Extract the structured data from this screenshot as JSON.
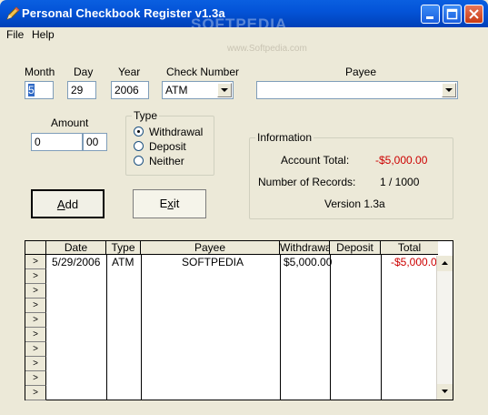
{
  "window": {
    "title": "Personal Checkbook Register v1.3a",
    "watermark": "SOFTPEDIA",
    "watermark_url": "www.Softpedia.com"
  },
  "menu": {
    "file": "File",
    "help": "Help"
  },
  "form": {
    "month_label": "Month",
    "month_value": "5",
    "day_label": "Day",
    "day_value": "29",
    "year_label": "Year",
    "year_value": "2006",
    "check_number_label": "Check Number",
    "check_number_value": "ATM",
    "payee_label": "Payee",
    "payee_value": "",
    "amount_label": "Amount",
    "amount_dollars": "0",
    "amount_cents": "00"
  },
  "type_group": {
    "title": "Type",
    "options": [
      "Withdrawal",
      "Deposit",
      "Neither"
    ],
    "selected": "Withdrawal"
  },
  "info": {
    "title": "Information",
    "account_total_label": "Account Total:",
    "account_total_value": "-$5,000.00",
    "records_label": "Number of Records:",
    "records_value": "1 / 1000",
    "version": "Version 1.3a"
  },
  "buttons": {
    "add_accel": "A",
    "add_rest": "dd",
    "exit_pre": "E",
    "exit_accel": "x",
    "exit_rest": "it"
  },
  "table": {
    "columns": [
      "Date",
      "Type",
      "Payee",
      "Withdrawal",
      "Deposit",
      "Total"
    ],
    "rows": [
      {
        "date": "5/29/2006",
        "type": "ATM",
        "payee": "SOFTPEDIA",
        "withdrawal": "$5,000.00",
        "deposit": "",
        "total": "-$5,000.00"
      }
    ],
    "row_marker": ">"
  },
  "colors": {
    "negative": "#CC0000",
    "title_bar": "#0454D8"
  }
}
